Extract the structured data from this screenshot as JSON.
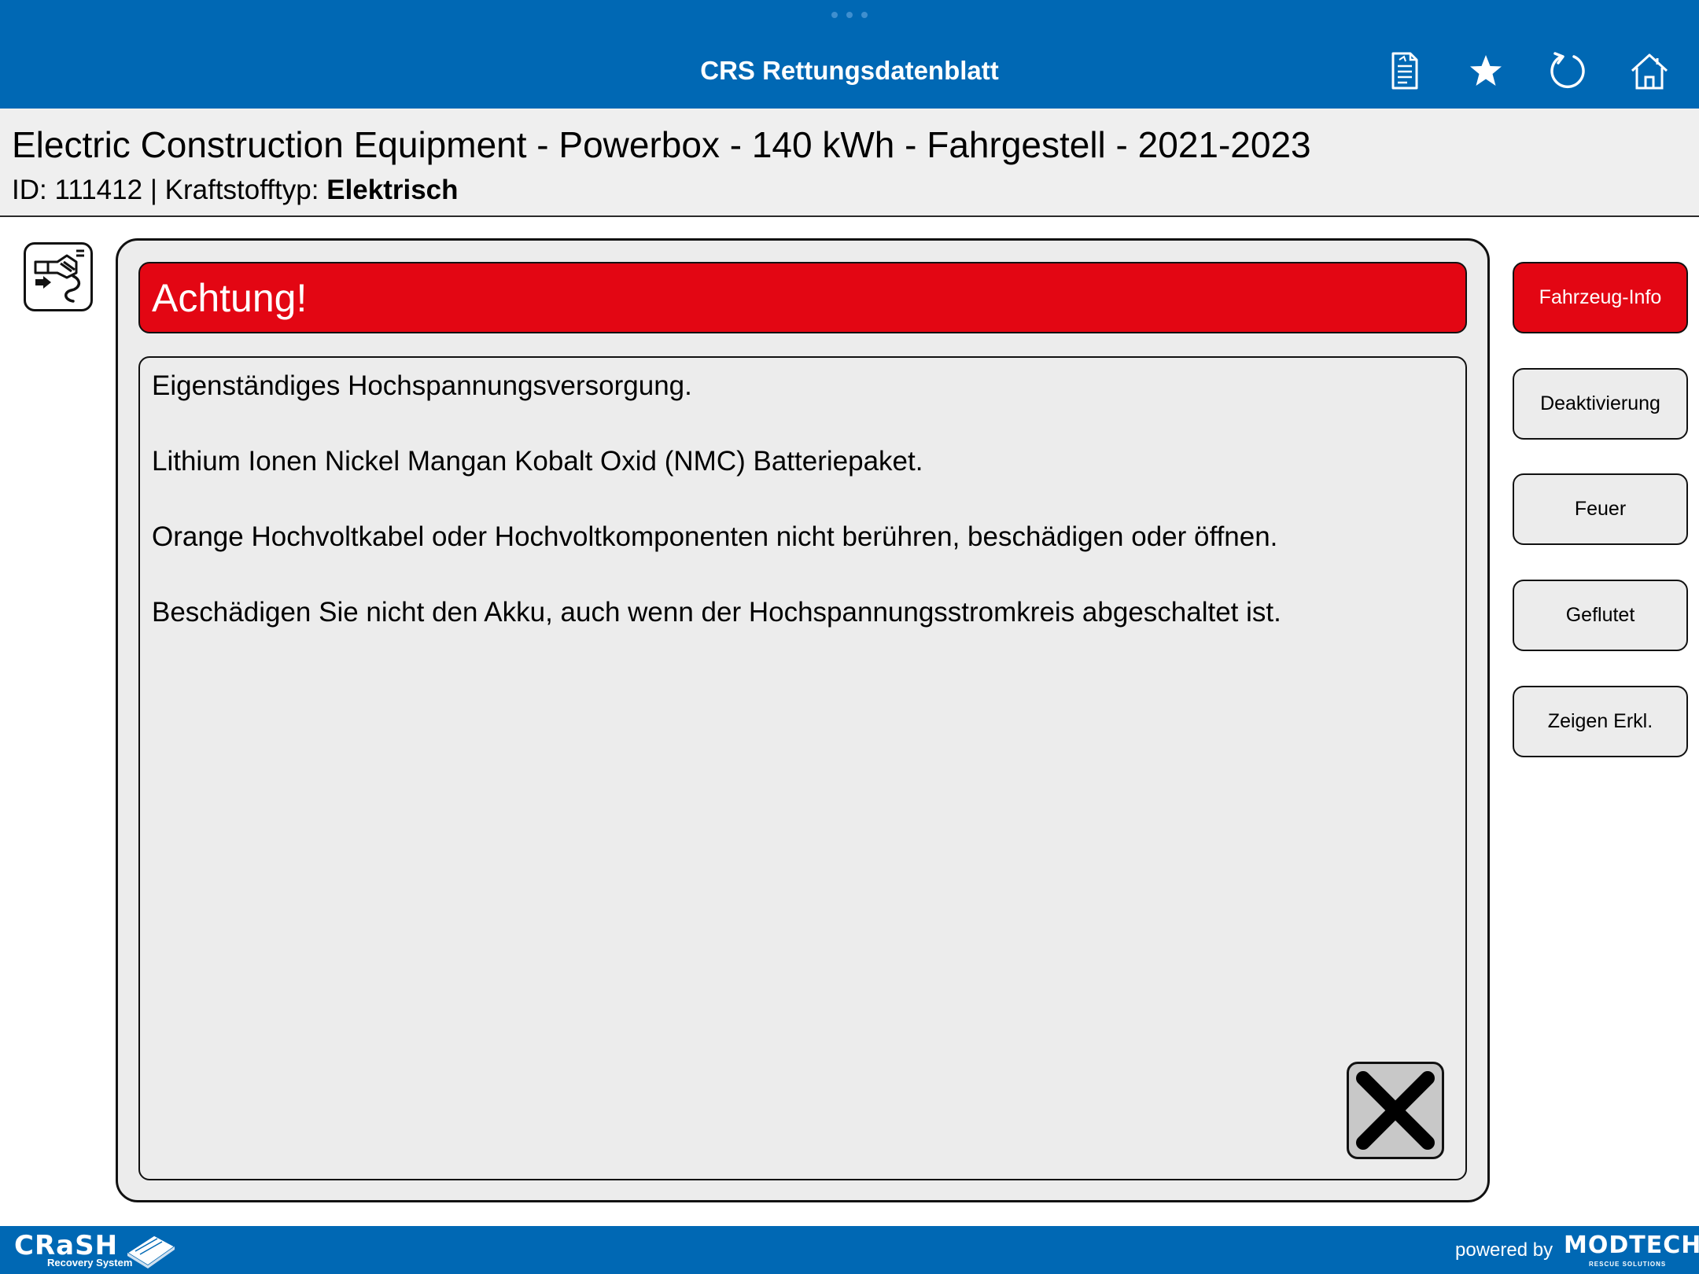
{
  "topbar": {
    "title": "CRS Rettungsdatenblatt",
    "icons": [
      "document-icon",
      "star-icon",
      "refresh-icon",
      "home-icon"
    ]
  },
  "vehicle": {
    "title": "Electric Construction Equipment - Powerbox - 140 kWh - Fahrgestell - 2021-2023",
    "id_label": "ID:",
    "id_value": "111412",
    "separator": "|",
    "fuel_label": "Kraftstofftyp:",
    "fuel_value": "Elektrisch",
    "fuel_icon": "electric-plug-icon"
  },
  "alert": {
    "title": "Achtung!",
    "lines": [
      "Eigenständiges Hochspannungsversorgung.",
      "Lithium Ionen Nickel Mangan Kobalt Oxid (NMC) Batteriepaket.",
      "Orange Hochvoltkabel oder Hochvoltkomponenten nicht berühren, beschädigen oder öffnen.",
      "Beschädigen Sie nicht den Akku, auch wenn der Hochspannungsstromkreis abgeschaltet ist."
    ]
  },
  "side_buttons": [
    {
      "label": "Fahrzeug-Info",
      "active": true
    },
    {
      "label": "Deaktivierung",
      "active": false
    },
    {
      "label": "Feuer",
      "active": false
    },
    {
      "label": "Geflutet",
      "active": false
    },
    {
      "label": "Zeigen Erkl.",
      "active": false
    }
  ],
  "footer": {
    "logo_word": "CRaSH",
    "logo_sub": "Recovery System",
    "powered_by": "powered by",
    "brand": "MODTECH",
    "brand_sub": "RESCUE SOLUTIONS"
  },
  "colors": {
    "bar_blue": "#0068b4",
    "alert_red": "#e30613",
    "panel_grey": "#ececec"
  }
}
